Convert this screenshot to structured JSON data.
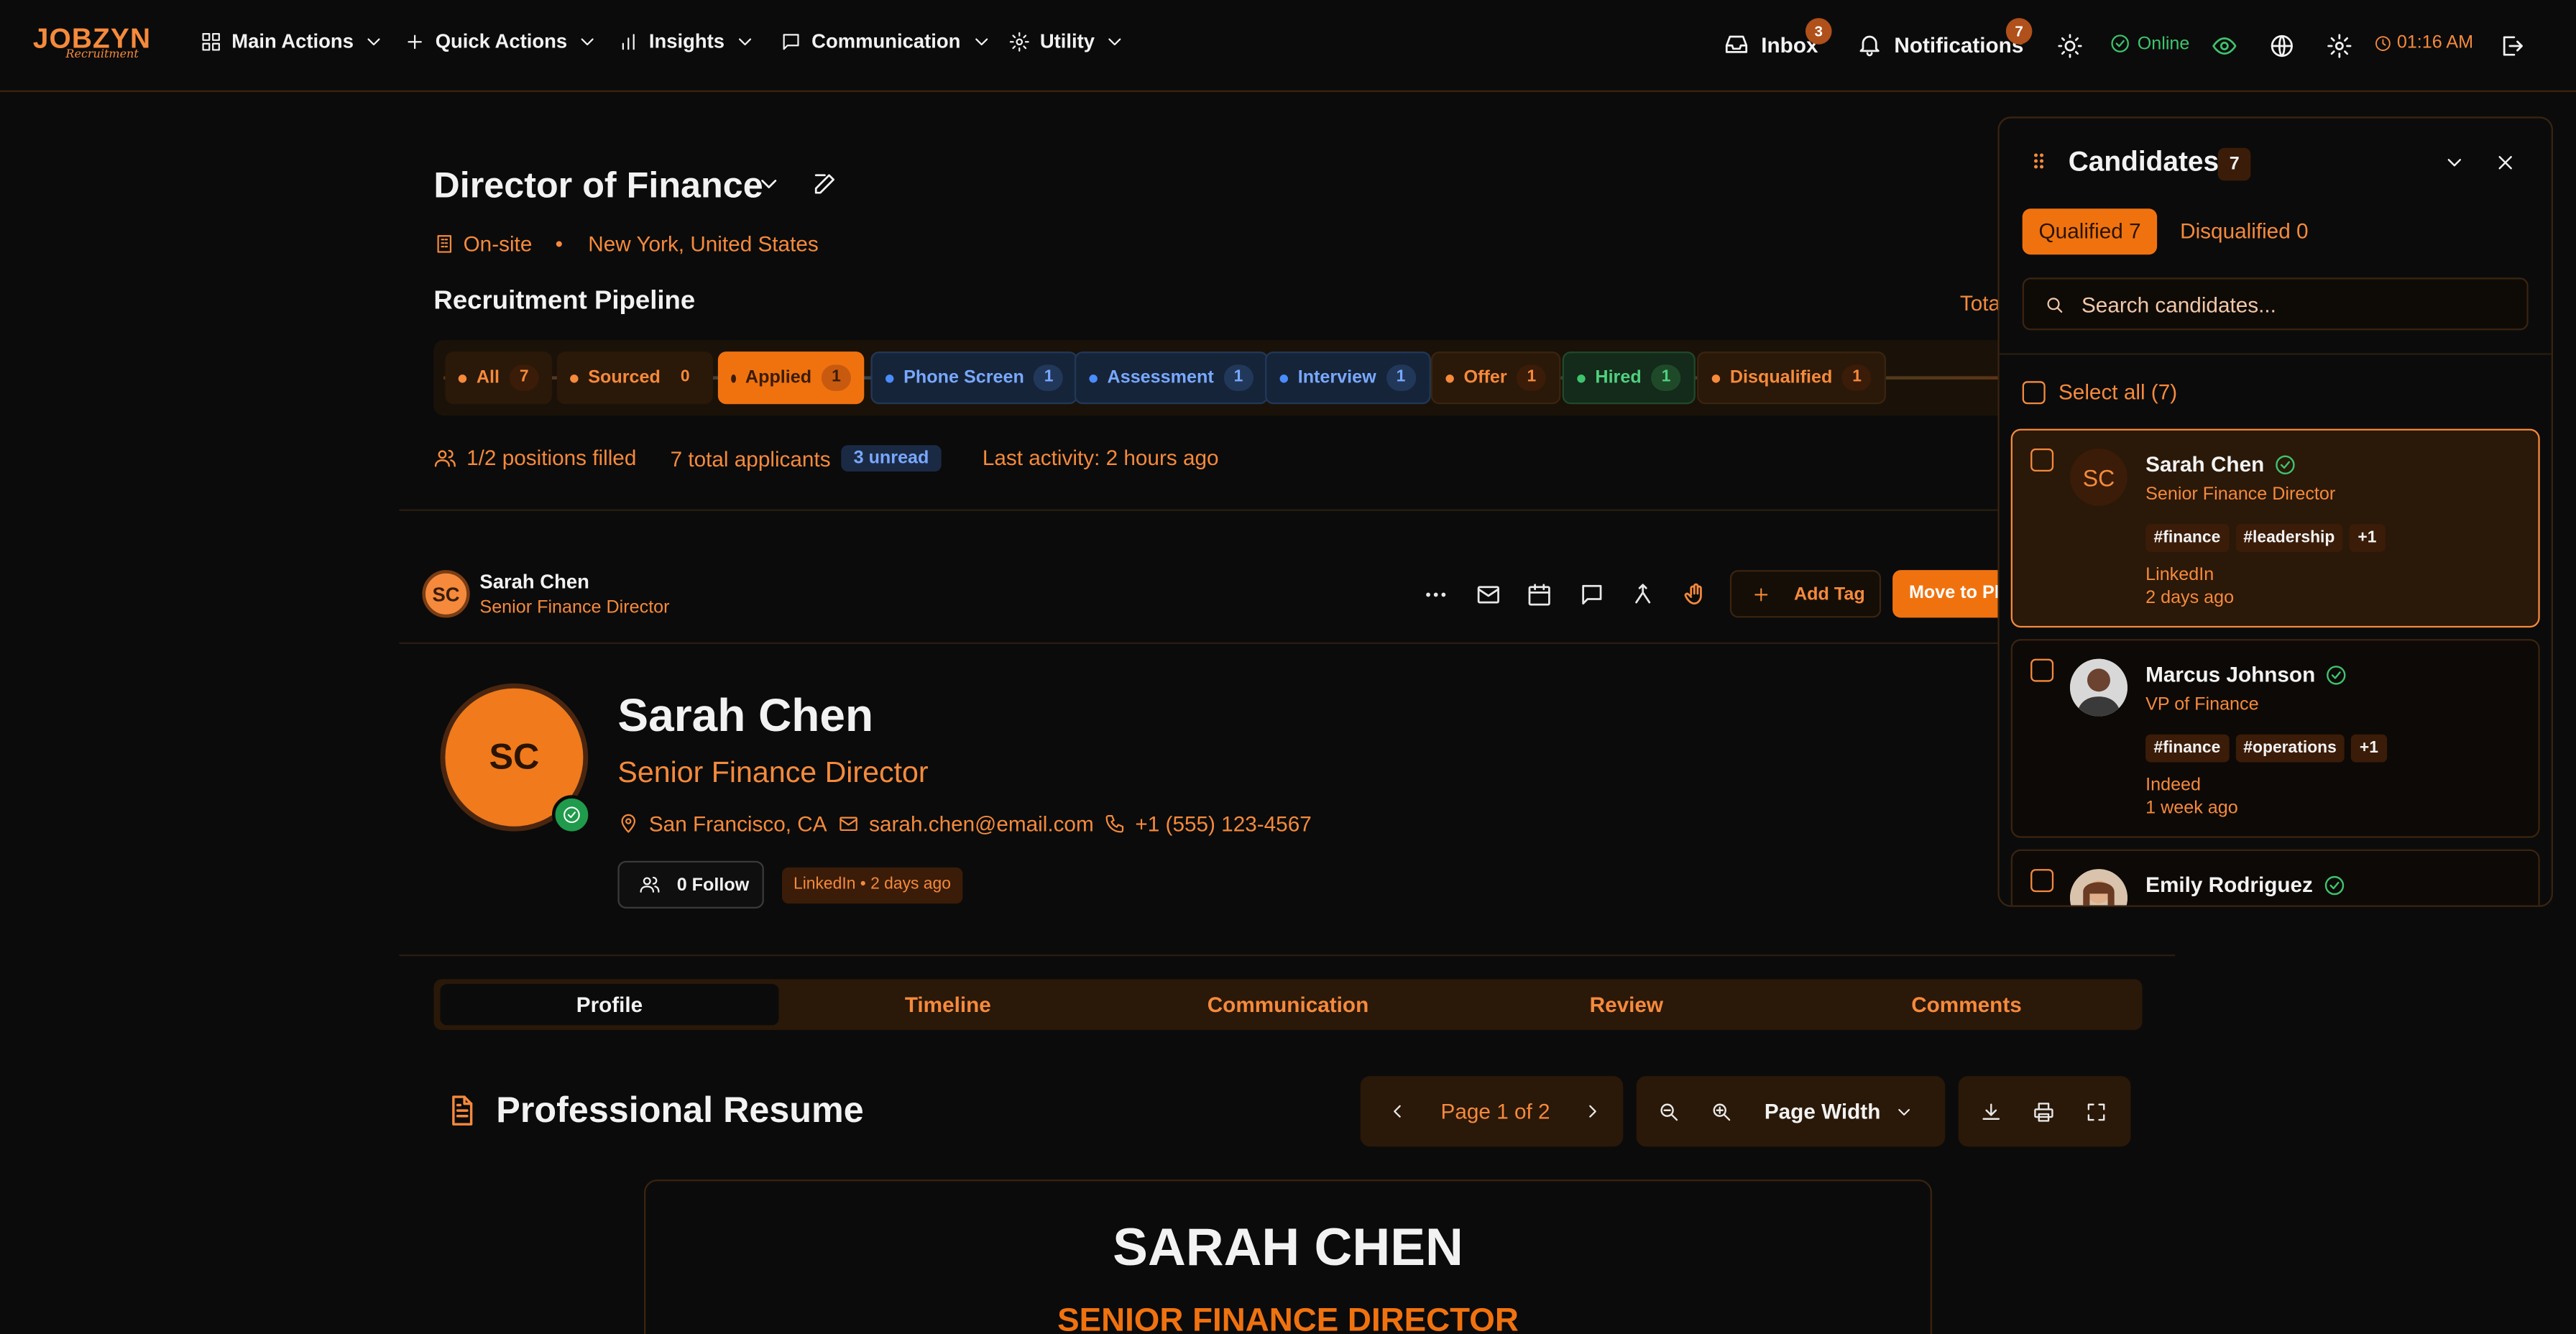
{
  "brand": {
    "name": "JOBZYN",
    "tagline": "Recruitment"
  },
  "nav": {
    "menus": [
      {
        "label": "Main Actions",
        "icon": "grid-icon"
      },
      {
        "label": "Quick Actions",
        "icon": "plus-icon"
      },
      {
        "label": "Insights",
        "icon": "bar-chart-icon"
      },
      {
        "label": "Communication",
        "icon": "message-icon"
      },
      {
        "label": "Utility",
        "icon": "gear-icon"
      }
    ],
    "inbox": {
      "label": "Inbox",
      "count": "3"
    },
    "notifications": {
      "label": "Notifications",
      "count": "7"
    },
    "status": "Online",
    "time": "01:16 AM"
  },
  "job": {
    "title": "Director of Finance",
    "workplace": "On-site",
    "location": "New York, United States"
  },
  "pipeline": {
    "title": "Recruitment Pipeline",
    "total_label": "Tota",
    "stages": [
      {
        "label": "All",
        "count": "7"
      },
      {
        "label": "Sourced",
        "count": "0"
      },
      {
        "label": "Applied",
        "count": "1"
      },
      {
        "label": "Phone Screen",
        "count": "1"
      },
      {
        "label": "Assessment",
        "count": "1"
      },
      {
        "label": "Interview",
        "count": "1"
      },
      {
        "label": "Offer",
        "count": "1"
      },
      {
        "label": "Hired",
        "count": "1"
      },
      {
        "label": "Disqualified",
        "count": "1"
      }
    ]
  },
  "stats": {
    "positions": "1/2 positions filled",
    "applicants": "7 total applicants",
    "unread": "3 unread",
    "activity": "Last activity: 2 hours ago"
  },
  "candidate_bar": {
    "initials": "SC",
    "name": "Sarah Chen",
    "title": "Senior Finance Director",
    "add_tag": "Add Tag",
    "move_to": "Move to Ph"
  },
  "profile": {
    "initials": "SC",
    "name": "Sarah Chen",
    "title": "Senior Finance Director",
    "location": "San Francisco, CA",
    "email": "sarah.chen@email.com",
    "phone": "+1 (555) 123-4567",
    "follow": "0 Follow",
    "source": "LinkedIn • 2 days ago"
  },
  "tabs": [
    "Profile",
    "Timeline",
    "Communication",
    "Review",
    "Comments"
  ],
  "resume": {
    "heading": "Professional Resume",
    "page": "Page 1 of 2",
    "zoom": "Page Width",
    "doc_name": "SARAH CHEN",
    "doc_title": "SENIOR FINANCE DIRECTOR"
  },
  "panel": {
    "title": "Candidates",
    "count": "7",
    "qualified": "Qualified 7",
    "disqualified": "Disqualified 0",
    "search_placeholder": "Search candidates...",
    "select_all": "Select all (7)",
    "candidates": [
      {
        "initials": "SC",
        "name": "Sarah Chen",
        "title": "Senior Finance Director",
        "tags": [
          "#finance",
          "#leadership",
          "+1"
        ],
        "source": "LinkedIn",
        "ago": "2 days ago"
      },
      {
        "initials": "",
        "name": "Marcus Johnson",
        "title": "VP of Finance",
        "tags": [
          "#finance",
          "#operations",
          "+1"
        ],
        "source": "Indeed",
        "ago": "1 week ago"
      },
      {
        "initials": "",
        "name": "Emily Rodriguez",
        "title": "",
        "tags": [],
        "source": "",
        "ago": ""
      }
    ]
  },
  "colors": {
    "accent": "#f58a3c",
    "primary_button": "#f0720f",
    "online": "#3ec46d",
    "background": "#0b0b0b"
  }
}
